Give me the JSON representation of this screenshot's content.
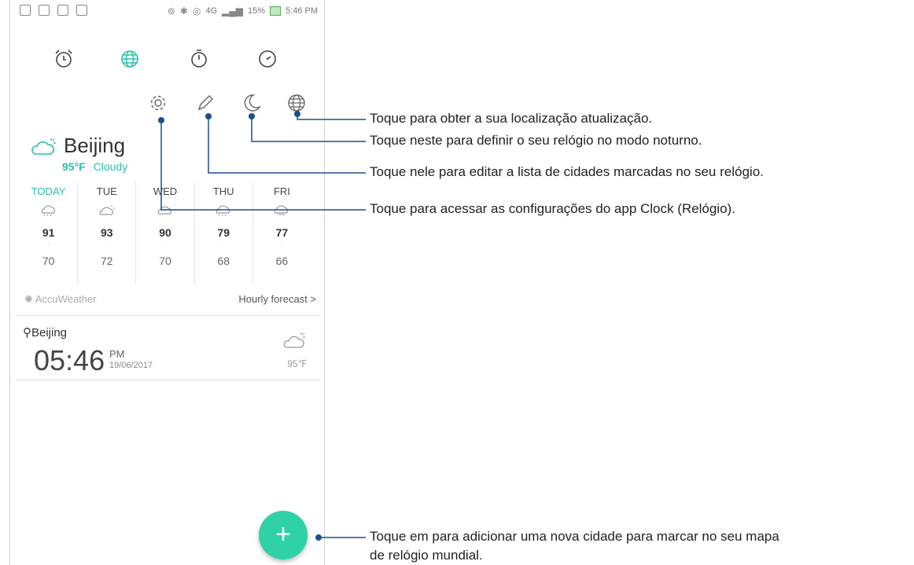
{
  "status_bar": {
    "network": "4G",
    "battery": "15%",
    "time": "5:46 PM"
  },
  "tabs": [
    "alarm-tab",
    "world-clock-tab",
    "stopwatch-tab",
    "timer-tab"
  ],
  "city": {
    "name": "Beijing",
    "temp": "95°F",
    "condition": "Cloudy"
  },
  "forecast": [
    {
      "day": "TODAY",
      "high": "91",
      "low": "70"
    },
    {
      "day": "TUE",
      "high": "93",
      "low": "72"
    },
    {
      "day": "WED",
      "high": "90",
      "low": "70"
    },
    {
      "day": "THU",
      "high": "79",
      "low": "68"
    },
    {
      "day": "FRI",
      "high": "77",
      "low": "66"
    }
  ],
  "provider": "AccuWeather",
  "hourly_link": "Hourly forecast >",
  "clock_card": {
    "location": "Beijing",
    "time": "05:46",
    "ampm": "PM",
    "date": "19/06/2017",
    "temp": "95℉"
  },
  "fab_label": "+",
  "callouts": {
    "location": "Toque para obter a sua localização atualização.",
    "night_mode": "Toque neste para definir o seu relógio no modo noturno.",
    "edit": "Toque nele para editar a lista de cidades marcadas no seu relógio.",
    "settings": "Toque para acessar as configurações do app Clock (Relógio).",
    "add_line1": "Toque em para adicionar uma nova cidade para marcar no seu mapa",
    "add_line2": "de relógio mundial."
  },
  "colors": {
    "accent": "#2bbfa8",
    "fab": "#2fd1a6"
  }
}
